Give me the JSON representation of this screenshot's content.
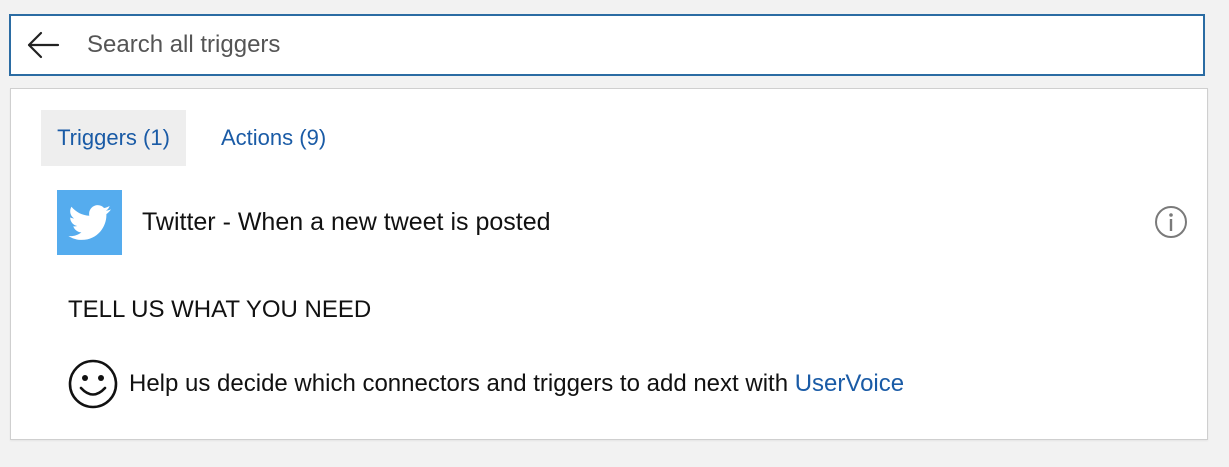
{
  "search": {
    "placeholder": "Search all triggers",
    "back_icon": "arrow-left-icon"
  },
  "tabs": [
    {
      "label": "Triggers (1)",
      "selected": true
    },
    {
      "label": "Actions (9)",
      "selected": false
    }
  ],
  "results": [
    {
      "icon": "twitter-icon",
      "icon_color": "#55acee",
      "label": "Twitter - When a new tweet is posted",
      "info_icon": "info-icon"
    }
  ],
  "feedback": {
    "title": "TELL US WHAT YOU NEED",
    "icon": "smiley-icon",
    "text": "Help us decide which connectors and triggers to add next with ",
    "link_text": "UserVoice"
  },
  "colors": {
    "accent": "#1a5ba6",
    "search_border": "#2b6ca3",
    "selected_tab_bg": "#eeeeee"
  }
}
